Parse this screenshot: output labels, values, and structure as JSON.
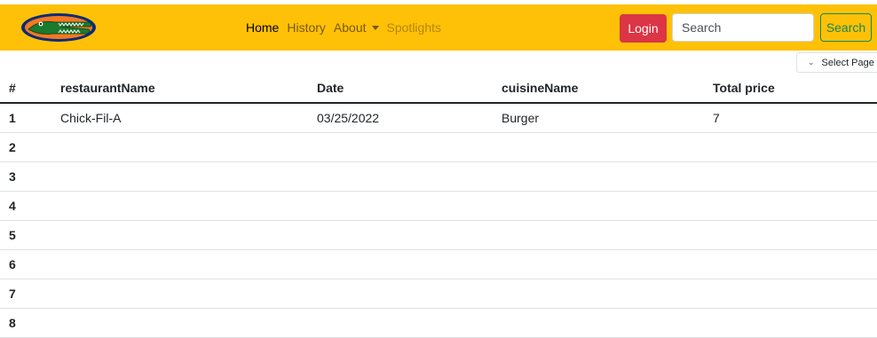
{
  "navbar": {
    "links": [
      {
        "label": "Home",
        "state": "active"
      },
      {
        "label": "History",
        "state": "normal"
      },
      {
        "label": "About",
        "state": "dropdown"
      },
      {
        "label": "Spotlights",
        "state": "disabled"
      }
    ],
    "login_label": "Login",
    "search": {
      "placeholder": "Search",
      "value": ""
    },
    "search_button_label": "Search",
    "colors": {
      "navbar_bg": "#ffc107",
      "login_bg": "#dc3545",
      "search_button": "#198754"
    },
    "logo_icon": "gator-logo-icon"
  },
  "page_select": {
    "label": "Select Page",
    "icon": "chevron-down-icon"
  },
  "table": {
    "columns": [
      "#",
      "restaurantName",
      "Date",
      "cuisineName",
      "Total price"
    ],
    "rows": [
      {
        "index": "1",
        "restaurantName": "Chick-Fil-A",
        "date": "03/25/2022",
        "cuisineName": "Burger",
        "totalPrice": "7"
      },
      {
        "index": "2",
        "restaurantName": "",
        "date": "",
        "cuisineName": "",
        "totalPrice": ""
      },
      {
        "index": "3",
        "restaurantName": "",
        "date": "",
        "cuisineName": "",
        "totalPrice": ""
      },
      {
        "index": "4",
        "restaurantName": "",
        "date": "",
        "cuisineName": "",
        "totalPrice": ""
      },
      {
        "index": "5",
        "restaurantName": "",
        "date": "",
        "cuisineName": "",
        "totalPrice": ""
      },
      {
        "index": "6",
        "restaurantName": "",
        "date": "",
        "cuisineName": "",
        "totalPrice": ""
      },
      {
        "index": "7",
        "restaurantName": "",
        "date": "",
        "cuisineName": "",
        "totalPrice": ""
      },
      {
        "index": "8",
        "restaurantName": "",
        "date": "",
        "cuisineName": "",
        "totalPrice": ""
      }
    ]
  }
}
